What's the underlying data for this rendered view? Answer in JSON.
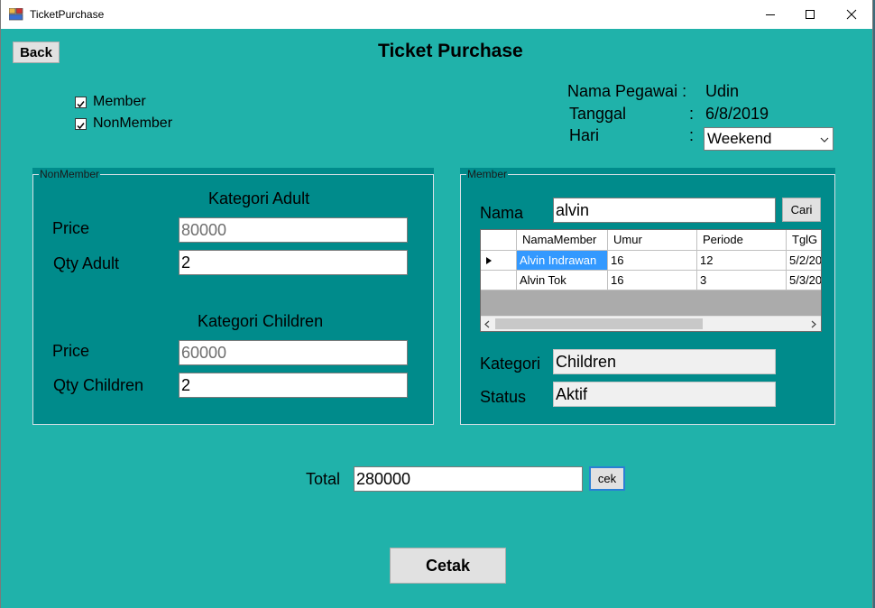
{
  "window": {
    "title": "TicketPurchase",
    "icon": "app-icon",
    "controls": [
      "minimize-icon",
      "maximize-icon",
      "close-icon"
    ]
  },
  "toolbar": {
    "back_label": "Back"
  },
  "header": {
    "title": "Ticket Purchase"
  },
  "membership": {
    "member_label": "Member",
    "member_checked": true,
    "nonmember_label": "NonMember",
    "nonmember_checked": true
  },
  "info": {
    "pegawai_label": "Nama Pegawai :",
    "pegawai_value": "Udin",
    "tanggal_label": "Tanggal",
    "tanggal_colon": ":",
    "tanggal_value": "6/8/2019",
    "hari_label": "Hari",
    "hari_colon": ":",
    "hari_value": "Weekend"
  },
  "nonmember": {
    "group_title": "NonMember",
    "adult_heading": "Kategori Adult",
    "adult_price_label": "Price",
    "adult_price_value": "80000",
    "adult_qty_label": "Qty Adult",
    "adult_qty_value": "2",
    "children_heading": "Kategori Children",
    "children_price_label": "Price",
    "children_price_value": "60000",
    "children_qty_label": "Qty Children",
    "children_qty_value": "2"
  },
  "member": {
    "group_title": "Member",
    "nama_label": "Nama",
    "nama_value": "alvin",
    "cari_label": "Cari",
    "grid": {
      "columns": [
        "NamaMember",
        "Umur",
        "Periode",
        "TglG"
      ],
      "rows": [
        [
          "Alvin Indrawan",
          "16",
          "12",
          "5/2/20"
        ],
        [
          "Alvin Tok",
          "16",
          "3",
          "5/3/20"
        ]
      ],
      "selected_row": 0
    },
    "kategori_label": "Kategori",
    "kategori_value": "Children",
    "status_label": "Status",
    "status_value": "Aktif"
  },
  "total": {
    "label": "Total",
    "value": "280000",
    "cek_label": "cek"
  },
  "cetak_label": "Cetak",
  "colors": {
    "form_bg": "#20B2AA",
    "group_bg": "#008B8B",
    "selection": "#3399ff"
  }
}
